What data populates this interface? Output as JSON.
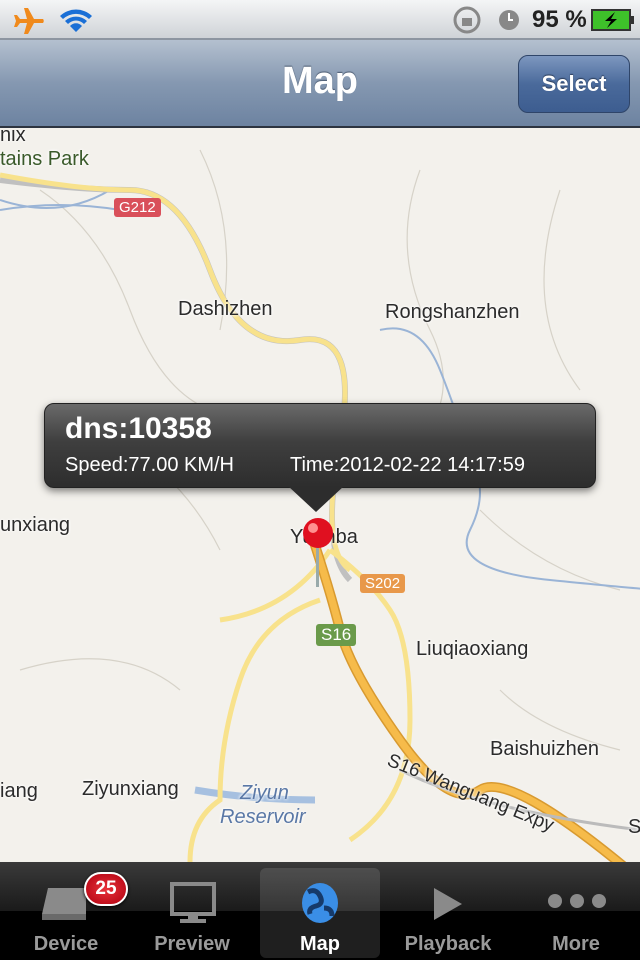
{
  "status": {
    "battery": "95 %",
    "icons": [
      "airplane-icon",
      "wifi-icon",
      "rotation-lock-icon",
      "alarm-icon",
      "battery-charging-icon"
    ]
  },
  "nav": {
    "title": "Map",
    "select_label": "Select"
  },
  "map": {
    "labels": {
      "phoenix": "nix",
      "park": "tains Park",
      "dashizhen": "Dashizhen",
      "rongshanzhen": "Rongshanzhen",
      "unxiang": "unxiang",
      "yuanba": "Yuanba",
      "liuqiaoxiang": "Liuqiaoxiang",
      "baishuizhen": "Baishuizhen",
      "iang": "iang",
      "ziyunxiang": "Ziyunxiang",
      "ziyun": "Ziyun",
      "reservoir": "Reservoir",
      "expy": "S16 Wanguang Expy",
      "edge_s": "S"
    },
    "shields": {
      "g212": "G212",
      "s202": "S202",
      "s16": "S16"
    }
  },
  "callout": {
    "title": "dns:10358",
    "speed": "Speed:77.00 KM/H",
    "time": "Time:2012-02-22 14:17:59"
  },
  "tabs": [
    {
      "label": "Device",
      "badge": "25",
      "icon": "device-icon"
    },
    {
      "label": "Preview",
      "icon": "monitor-icon"
    },
    {
      "label": "Map",
      "icon": "globe-icon",
      "active": true
    },
    {
      "label": "Playback",
      "icon": "play-icon"
    },
    {
      "label": "More",
      "icon": "more-icon"
    }
  ],
  "colors": {
    "nav": "#7a8fab",
    "g212": "#d9505a",
    "s202": "#e8984a",
    "s16": "#6a9a4a",
    "highway": "#f5b94a",
    "pin": "#e01020"
  }
}
